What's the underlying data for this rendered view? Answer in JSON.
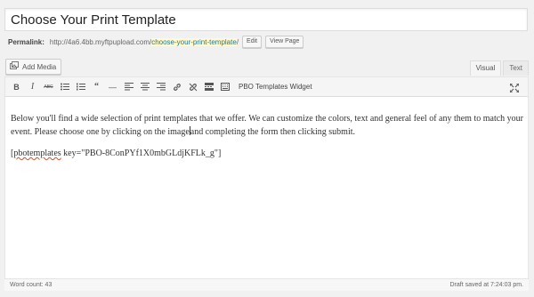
{
  "title_input": {
    "value": "Choose Your Print Template"
  },
  "permalink": {
    "label": "Permalink:",
    "base": "http://4a6.4bb.myftpupload.com/",
    "slug": "choose-your-print-template",
    "suffix": "/",
    "edit_label": "Edit",
    "view_label": "View Page"
  },
  "media": {
    "add_media_label": "Add Media"
  },
  "editor_tabs": {
    "visual": "Visual",
    "text": "Text"
  },
  "toolbar": {
    "bold": "B",
    "italic": "I",
    "strikethrough": "ABC",
    "blockquote": "66",
    "hr": "—",
    "widget_label": "PBO Templates Widget"
  },
  "content": {
    "paragraph1": "Below you'll find a wide selection of print templates that we offer. We can customize the colors, text and general feel of any them to match your event. Please choose one by clicking on the image",
    "paragraph1_after_caret": "and completing the form then clicking submit.",
    "shortcode_prefix": "[",
    "shortcode_word": "pbotemplates",
    "shortcode_rest": " key=\"PBO-8ConPYf1X0mbGLdjKFLk_g\"]"
  },
  "status": {
    "word_count": "Word count: 43",
    "draft_saved": "Draft saved at 7:24:03 pm."
  }
}
